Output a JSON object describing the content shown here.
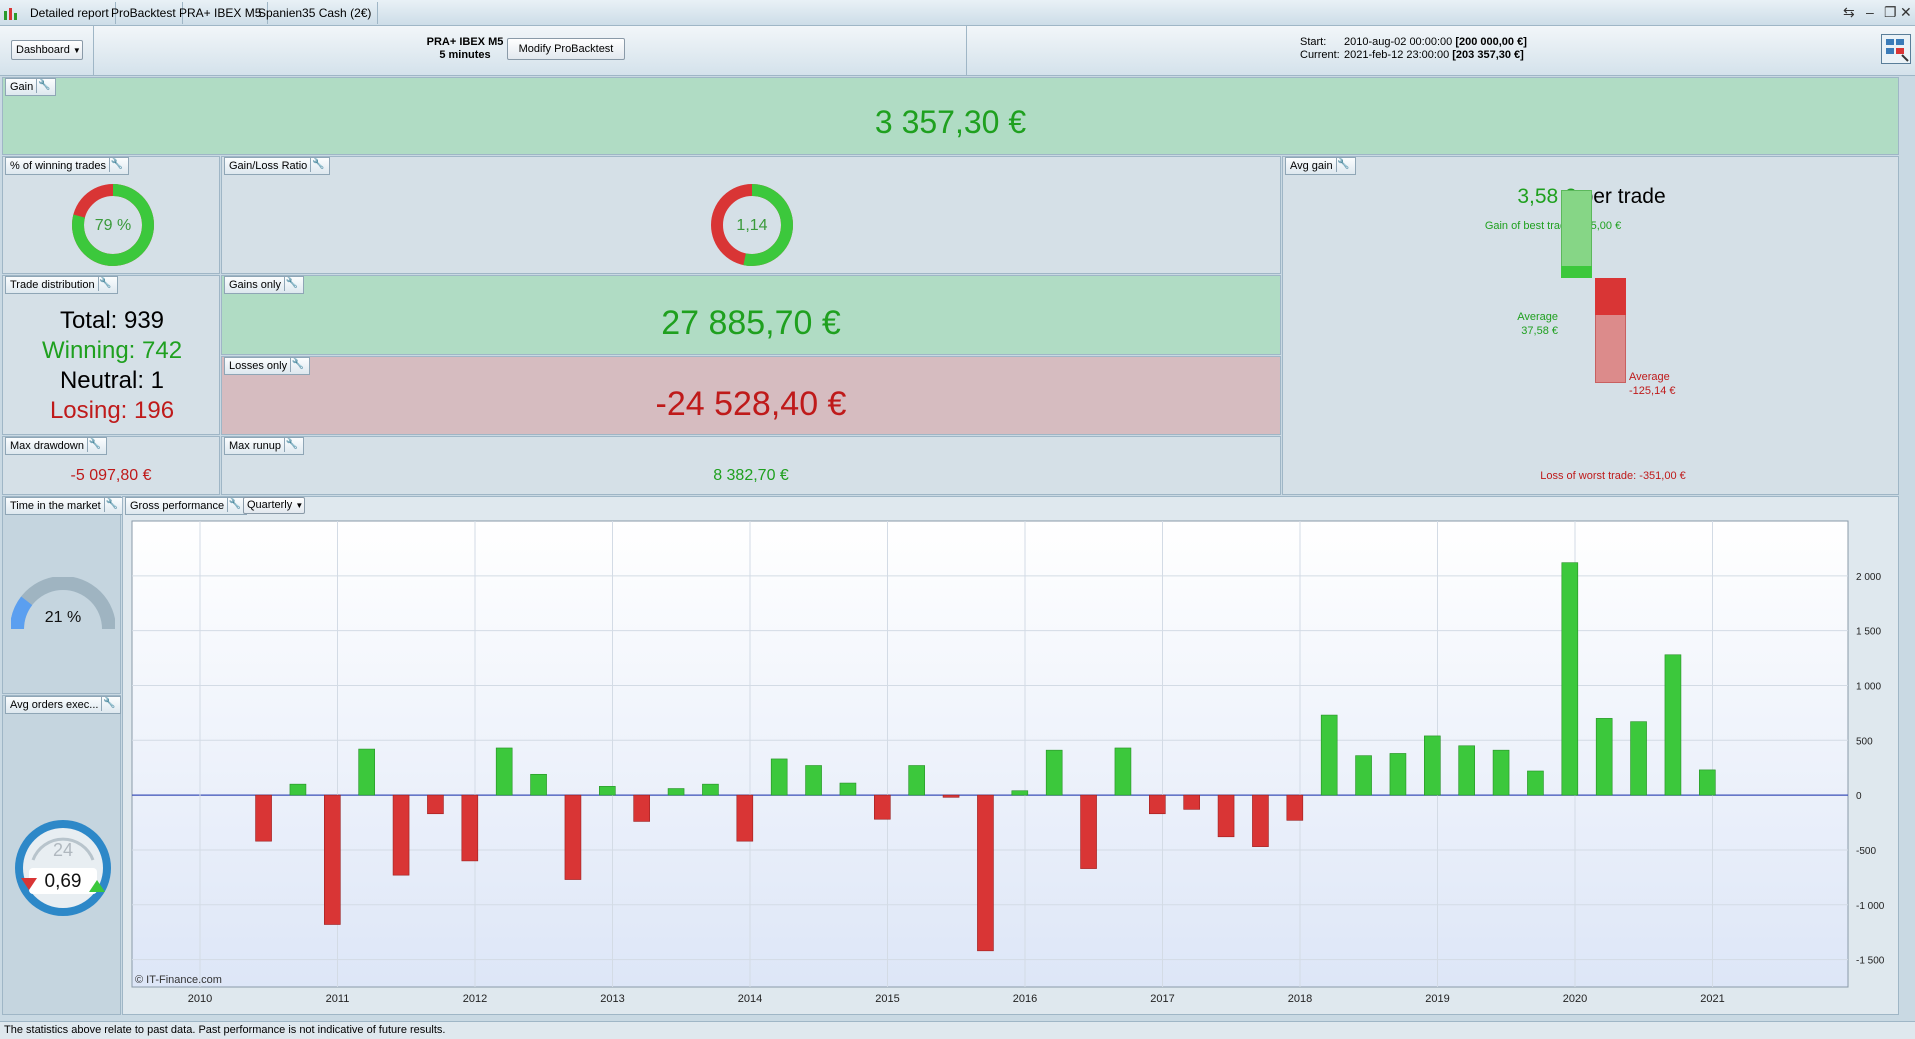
{
  "titlebar": {
    "tabs": [
      "Detailed report",
      "ProBacktest",
      "PRA+ IBEX M5",
      "Spanien35 Cash (2€)"
    ],
    "window_buttons": [
      "share-icon",
      "minimize-icon",
      "restore-icon",
      "close-icon"
    ]
  },
  "header": {
    "dashboard_label": "Dashboard",
    "strategy_name": "PRA+ IBEX M5",
    "timeframe": "5 minutes",
    "modify_label": "Modify ProBacktest",
    "start_label": "Start:",
    "start_date": "2010-aug-02 00:00:00",
    "start_value": "[200 000,00 €]",
    "current_label": "Current:",
    "current_date": "2021-feb-12 23:00:00",
    "current_value": "[203 357,30 €]"
  },
  "gain": {
    "title": "Gain",
    "value": "3 357,30 €"
  },
  "winning_pct": {
    "title": "% of winning trades",
    "value": "79 %",
    "fraction": 0.79
  },
  "gain_loss_ratio": {
    "title": "Gain/Loss Ratio",
    "value": "1,14",
    "fraction": 0.533
  },
  "avg_gain": {
    "title": "Avg gain",
    "value": "3,58 €",
    "suffix": "per trade",
    "best_label": "Gain of best trade: 275,00 €",
    "avg_gain_label": "Average",
    "avg_gain_value": "37,58 €",
    "avg_loss_label": "Average",
    "avg_loss_value": "-125,14 €",
    "worst_label": "Loss of worst trade: -351,00 €",
    "best": 275.0,
    "avg_win": 37.58,
    "avg_loss": -125.14,
    "worst": -351.0
  },
  "distribution": {
    "title": "Trade distribution",
    "total": "Total: 939",
    "winning": "Winning: 742",
    "neutral": "Neutral: 1",
    "losing": "Losing: 196"
  },
  "gains_only": {
    "title": "Gains only",
    "value": "27 885,70 €"
  },
  "losses_only": {
    "title": "Losses only",
    "value": "-24 528,40 €"
  },
  "max_drawdown": {
    "title": "Max drawdown",
    "value": "-5 097,80 €"
  },
  "max_runup": {
    "title": "Max runup",
    "value": "8 382,70 €"
  },
  "time_in_market": {
    "title": "Time in the market",
    "value": "21 %",
    "fraction": 0.21
  },
  "avg_orders": {
    "title": "Avg orders exec...",
    "value": "0,69",
    "dial_number": "24"
  },
  "gross_performance": {
    "title": "Gross performance",
    "period_label": "Quarterly"
  },
  "footer": {
    "text": "The statistics above relate to past data. Past performance is not indicative of future results."
  },
  "chart_data": {
    "type": "bar",
    "title": "",
    "xlabel": "",
    "ylabel": "",
    "ylim": [
      -1750,
      2500
    ],
    "yticks": [
      2000,
      1500,
      1000,
      500,
      0,
      -500,
      -1000,
      -1500
    ],
    "ytick_labels": [
      "2 000",
      "1 500",
      "1 000",
      "500",
      "0",
      "-500",
      "-1 000",
      "-1 500"
    ],
    "xticks": [
      "2010",
      "2011",
      "2012",
      "2013",
      "2014",
      "2015",
      "2016",
      "2017",
      "2018",
      "2019",
      "2020",
      "2021"
    ],
    "credit": "© IT-Finance.com",
    "categories": [
      "2010 Q3",
      "2010 Q4",
      "2011 Q1",
      "2011 Q2",
      "2011 Q3",
      "2011 Q4",
      "2012 Q1",
      "2012 Q2",
      "2012 Q3",
      "2012 Q4",
      "2013 Q1",
      "2013 Q2",
      "2013 Q3",
      "2013 Q4",
      "2014 Q1",
      "2014 Q2",
      "2014 Q3",
      "2014 Q4",
      "2015 Q1",
      "2015 Q2",
      "2015 Q3",
      "2015 Q4",
      "2016 Q1",
      "2016 Q2",
      "2016 Q3",
      "2016 Q4",
      "2017 Q1",
      "2017 Q2",
      "2017 Q3",
      "2017 Q4",
      "2018 Q1",
      "2018 Q2",
      "2018 Q3",
      "2018 Q4",
      "2019 Q1",
      "2019 Q2",
      "2019 Q3",
      "2019 Q4",
      "2020 Q1",
      "2020 Q2",
      "2020 Q3",
      "2020 Q4",
      "2021 Q1"
    ],
    "values": [
      -420,
      100,
      -1180,
      420,
      -730,
      -170,
      -600,
      430,
      190,
      -770,
      80,
      -240,
      60,
      100,
      -420,
      330,
      270,
      110,
      -220,
      270,
      -20,
      -1420,
      40,
      410,
      -670,
      430,
      -170,
      -130,
      -380,
      -470,
      -230,
      730,
      360,
      380,
      540,
      450,
      410,
      220,
      2120,
      700,
      670,
      1280,
      230
    ],
    "positive_color": "#3cc83c",
    "negative_color": "#d93535"
  }
}
